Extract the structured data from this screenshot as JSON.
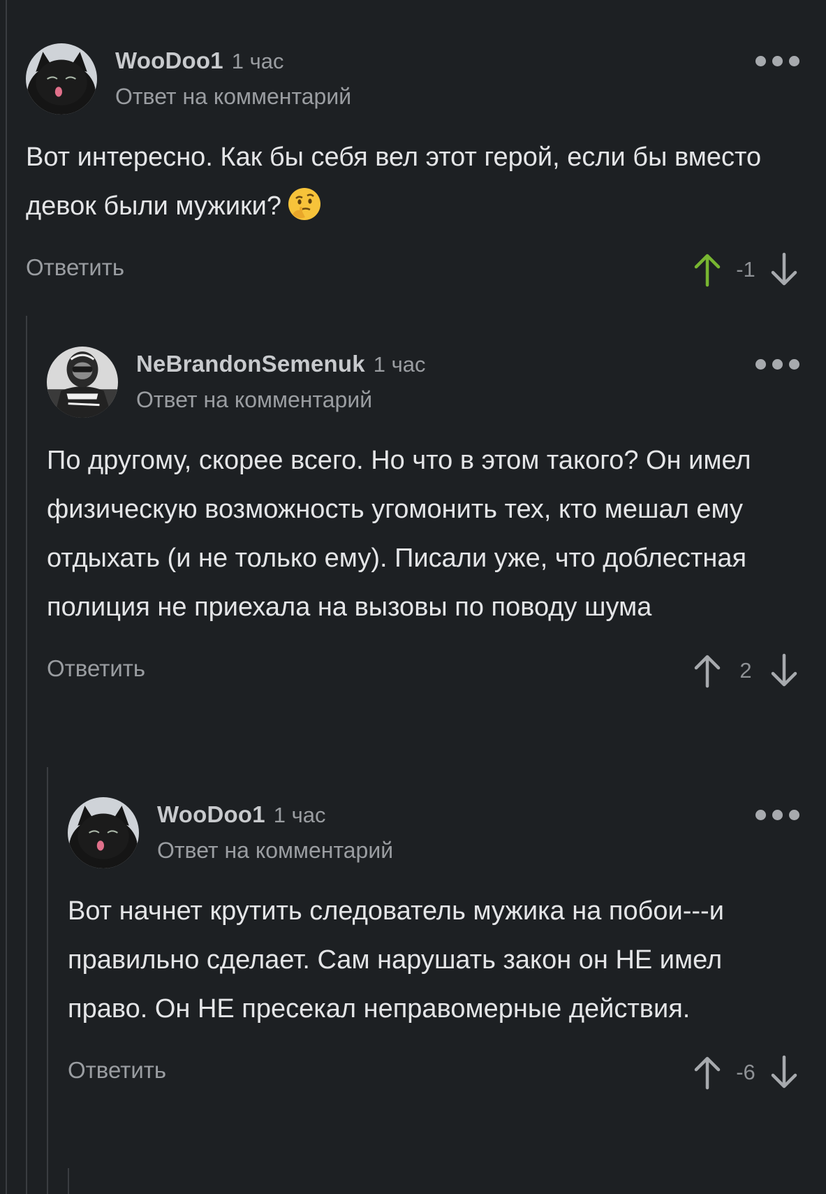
{
  "colors": {
    "background": "#1d2023",
    "text": "#e4e5e7",
    "muted": "#9a9da1",
    "upvote_active": "#78b631",
    "thread_line": "#3a3d41"
  },
  "comments": [
    {
      "author": "WooDoo1",
      "time": "1 час",
      "reply_to": "Ответ на комментарий",
      "text": "Вот интересно. Как бы себя вел этот герой, если бы вместо девок были мужики?",
      "emoji": "thinking-face-icon",
      "reply_label": "Ответить",
      "rating": "-1",
      "upvoted": true
    },
    {
      "author": "NeBrandonSemenuk",
      "time": "1 час",
      "reply_to": "Ответ на комментарий",
      "text": "По другому, скорее всего. Но что в этом такого? Он имел физическую возможность угомонить тех, кто мешал ему отдыхать (и не только ему). Писали уже, что доблестная полиция не приехала на вызовы по поводу шума",
      "reply_label": "Ответить",
      "rating": "2",
      "upvoted": false
    },
    {
      "author": "WooDoo1",
      "time": "1 час",
      "reply_to": "Ответ на комментарий",
      "text": "Вот начнет крутить следователь мужика на побои---и правильно сделает. Сам нарушать закон он НЕ имел право. Он НЕ пресекал неправомерные действия.",
      "reply_label": "Ответить",
      "rating": "-6",
      "upvoted": false
    }
  ]
}
